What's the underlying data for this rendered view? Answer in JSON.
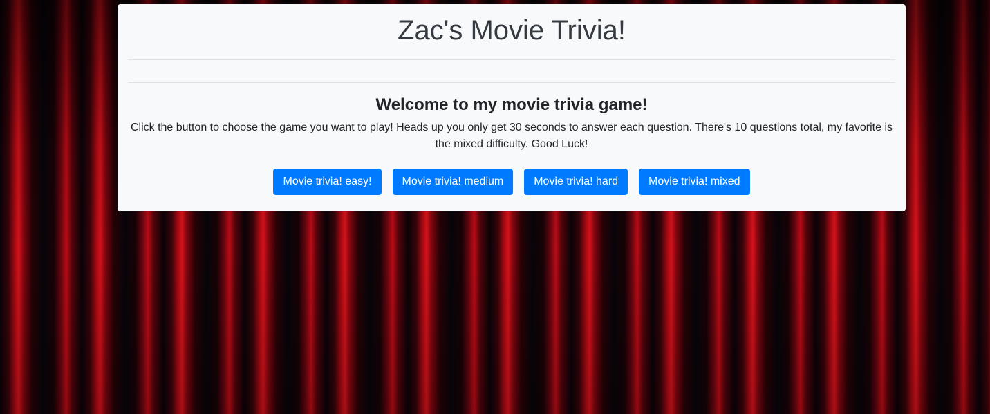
{
  "header": {
    "title": "Zac's Movie Trivia!"
  },
  "intro": {
    "heading": "Welcome to my movie trivia game!",
    "description": "Click the button to choose the game you want to play! Heads up you only get 30 seconds to answer each question. There's 10 questions total, my favorite is the mixed difficulty. Good Luck!"
  },
  "buttons": [
    {
      "label": "Movie trivia! easy!"
    },
    {
      "label": "Movie trivia! medium"
    },
    {
      "label": "Movie trivia! hard"
    },
    {
      "label": "Movie trivia! mixed"
    }
  ],
  "colors": {
    "button_primary": "#007bff",
    "card_background": "#f8f9fa",
    "curtain_red": "#c40c16"
  }
}
